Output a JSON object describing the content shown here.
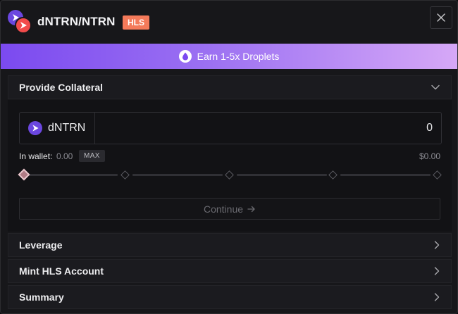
{
  "header": {
    "title": "dNTRN/NTRN",
    "badge": "HLS"
  },
  "banner": {
    "text": "Earn 1-5x Droplets"
  },
  "collateral": {
    "section_label": "Provide Collateral",
    "asset": "dNTRN",
    "amount_value": "0",
    "wallet_label": "In wallet:",
    "wallet_value": "0.00",
    "max_label": "MAX",
    "usd_value": "$0.00",
    "slider_percent": 0,
    "continue_label": "Continue"
  },
  "sections": {
    "leverage": "Leverage",
    "mint": "Mint HLS Account",
    "summary": "Summary"
  },
  "colors": {
    "badge": "#f47a5a",
    "banner_start": "#7b4af0",
    "banner_end": "#d6a8f7",
    "dntrn_coin": "#6b47e0",
    "ntrn_coin": "#f24b4b"
  }
}
